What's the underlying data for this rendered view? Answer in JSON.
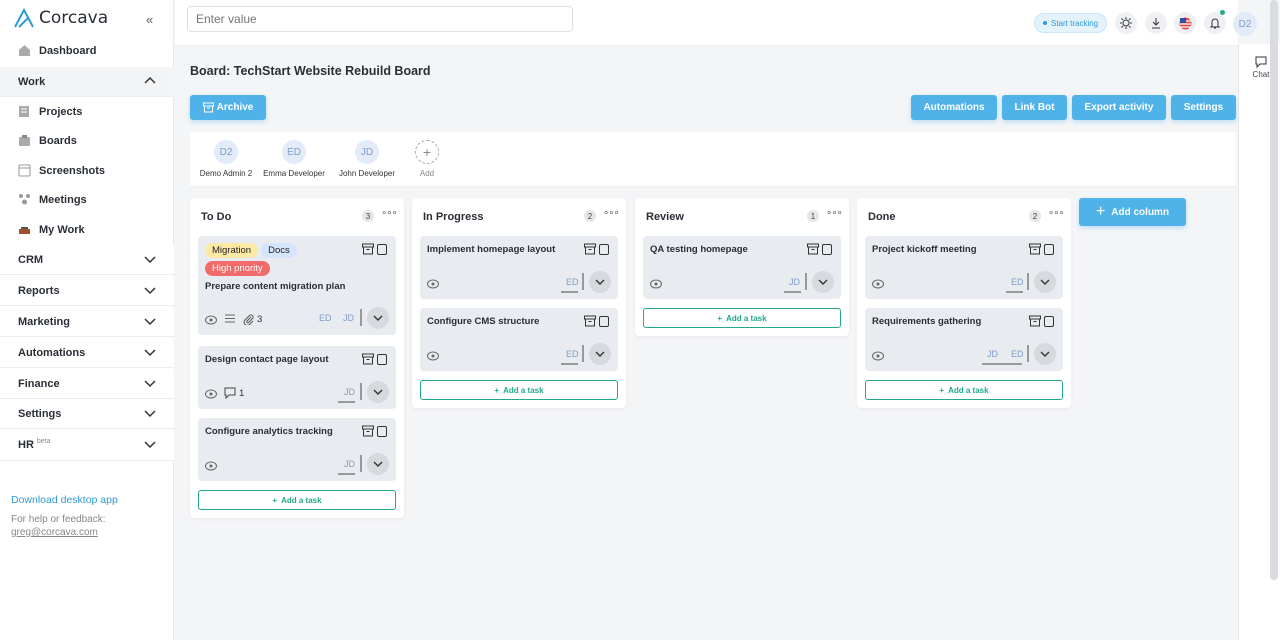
{
  "app": {
    "name": "Corcava"
  },
  "sidebar": {
    "items": [
      {
        "label": "Dashboard",
        "icon": "dashboard-icon"
      },
      {
        "label": "Projects",
        "icon": "projects-icon"
      },
      {
        "label": "Boards",
        "icon": "boards-icon"
      },
      {
        "label": "Screenshots",
        "icon": "screenshots-icon"
      },
      {
        "label": "Meetings",
        "icon": "meetings-icon"
      },
      {
        "label": "My Work",
        "icon": "my-work-icon"
      }
    ],
    "sections": [
      {
        "label": "Work",
        "state": "open"
      },
      {
        "label": "CRM"
      },
      {
        "label": "Reports"
      },
      {
        "label": "Marketing"
      },
      {
        "label": "Automations"
      },
      {
        "label": "Finance"
      },
      {
        "label": "Settings"
      },
      {
        "label": "HR",
        "badge": "beta"
      }
    ],
    "download_label": "Download desktop app",
    "help_label": "For help or feedback:",
    "help_email": "greg@corcava.com"
  },
  "topbar": {
    "search_placeholder": "Enter value",
    "track_label": "Start tracking",
    "avatar": "D2"
  },
  "chat_label": "Chat",
  "board": {
    "title": "Board: TechStart Website Rebuild Board",
    "archive_label": "Archive",
    "actions": [
      "Automations",
      "Link Bot",
      "Export activity",
      "Settings"
    ],
    "members": [
      {
        "initials": "D2",
        "name": "Demo Admin 2"
      },
      {
        "initials": "ED",
        "name": "Emma Developer"
      },
      {
        "initials": "JD",
        "name": "John Developer"
      }
    ],
    "add_member_label": "Add",
    "add_task_label": "Add a task",
    "add_column_label": "Add column",
    "columns": [
      {
        "name": "To Do",
        "count": "3",
        "cards": [
          {
            "title": "Prepare content migration plan",
            "tags": [
              "Migration",
              "Docs",
              "High priority"
            ],
            "attachments": "3",
            "assignees": [
              "ED",
              "JD"
            ]
          },
          {
            "title": "Design contact page layout",
            "comments": "1",
            "assignees": [
              "JD"
            ]
          },
          {
            "title": "Configure analytics tracking",
            "assignees": [
              "JD"
            ]
          }
        ]
      },
      {
        "name": "In Progress",
        "count": "2",
        "cards": [
          {
            "title": "Implement homepage layout",
            "assignees": [
              "ED"
            ]
          },
          {
            "title": "Configure CMS structure",
            "assignees": [
              "ED"
            ]
          }
        ]
      },
      {
        "name": "Review",
        "count": "1",
        "cards": [
          {
            "title": "QA testing homepage",
            "assignees": [
              "JD"
            ]
          }
        ]
      },
      {
        "name": "Done",
        "count": "2",
        "cards": [
          {
            "title": "Project kickoff meeting",
            "assignees": [
              "ED"
            ]
          },
          {
            "title": "Requirements gathering",
            "assignees": [
              "JD",
              "ED"
            ]
          }
        ]
      }
    ]
  },
  "colors": {
    "accent": "#4fb3ea",
    "success": "#22a88a",
    "tag_migration": "#fde9a6",
    "tag_docs": "#d3e4fb",
    "tag_priority": "#f26b6b"
  }
}
